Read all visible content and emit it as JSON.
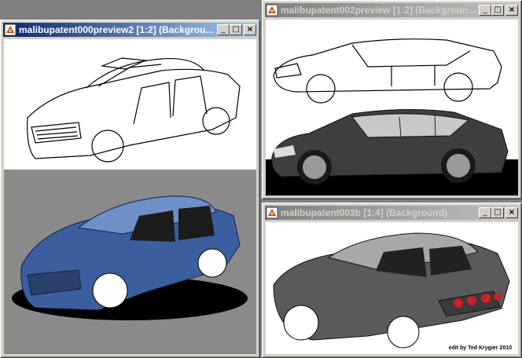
{
  "windows": [
    {
      "title": "malibupatent000preview2 [1:2] (Backgrou..."
    },
    {
      "title": "malibupatent002preview [1:2] (Backgroun..."
    },
    {
      "title": "malibupatent003b [1:4] (Background)"
    }
  ],
  "buttons": {
    "minimize": "_",
    "maximize": "□",
    "close": "×"
  },
  "caption": "edit by Ted Krygier 2010",
  "colors": {
    "title_active": "#0a246a",
    "title_inactive": "#808080",
    "car_blue": "#3b5f9e",
    "car_gray": "#555555"
  },
  "icons": [
    "app-icon",
    "minimize-icon",
    "maximize-icon",
    "close-icon"
  ]
}
